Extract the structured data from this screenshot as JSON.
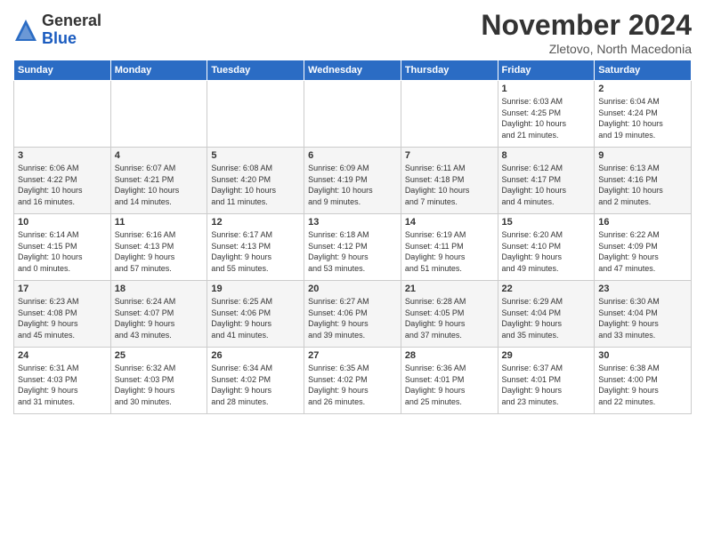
{
  "logo": {
    "general": "General",
    "blue": "Blue"
  },
  "title": "November 2024",
  "subtitle": "Zletovo, North Macedonia",
  "headers": [
    "Sunday",
    "Monday",
    "Tuesday",
    "Wednesday",
    "Thursday",
    "Friday",
    "Saturday"
  ],
  "weeks": [
    [
      {
        "day": "",
        "info": ""
      },
      {
        "day": "",
        "info": ""
      },
      {
        "day": "",
        "info": ""
      },
      {
        "day": "",
        "info": ""
      },
      {
        "day": "",
        "info": ""
      },
      {
        "day": "1",
        "info": "Sunrise: 6:03 AM\nSunset: 4:25 PM\nDaylight: 10 hours\nand 21 minutes."
      },
      {
        "day": "2",
        "info": "Sunrise: 6:04 AM\nSunset: 4:24 PM\nDaylight: 10 hours\nand 19 minutes."
      }
    ],
    [
      {
        "day": "3",
        "info": "Sunrise: 6:06 AM\nSunset: 4:22 PM\nDaylight: 10 hours\nand 16 minutes."
      },
      {
        "day": "4",
        "info": "Sunrise: 6:07 AM\nSunset: 4:21 PM\nDaylight: 10 hours\nand 14 minutes."
      },
      {
        "day": "5",
        "info": "Sunrise: 6:08 AM\nSunset: 4:20 PM\nDaylight: 10 hours\nand 11 minutes."
      },
      {
        "day": "6",
        "info": "Sunrise: 6:09 AM\nSunset: 4:19 PM\nDaylight: 10 hours\nand 9 minutes."
      },
      {
        "day": "7",
        "info": "Sunrise: 6:11 AM\nSunset: 4:18 PM\nDaylight: 10 hours\nand 7 minutes."
      },
      {
        "day": "8",
        "info": "Sunrise: 6:12 AM\nSunset: 4:17 PM\nDaylight: 10 hours\nand 4 minutes."
      },
      {
        "day": "9",
        "info": "Sunrise: 6:13 AM\nSunset: 4:16 PM\nDaylight: 10 hours\nand 2 minutes."
      }
    ],
    [
      {
        "day": "10",
        "info": "Sunrise: 6:14 AM\nSunset: 4:15 PM\nDaylight: 10 hours\nand 0 minutes."
      },
      {
        "day": "11",
        "info": "Sunrise: 6:16 AM\nSunset: 4:13 PM\nDaylight: 9 hours\nand 57 minutes."
      },
      {
        "day": "12",
        "info": "Sunrise: 6:17 AM\nSunset: 4:13 PM\nDaylight: 9 hours\nand 55 minutes."
      },
      {
        "day": "13",
        "info": "Sunrise: 6:18 AM\nSunset: 4:12 PM\nDaylight: 9 hours\nand 53 minutes."
      },
      {
        "day": "14",
        "info": "Sunrise: 6:19 AM\nSunset: 4:11 PM\nDaylight: 9 hours\nand 51 minutes."
      },
      {
        "day": "15",
        "info": "Sunrise: 6:20 AM\nSunset: 4:10 PM\nDaylight: 9 hours\nand 49 minutes."
      },
      {
        "day": "16",
        "info": "Sunrise: 6:22 AM\nSunset: 4:09 PM\nDaylight: 9 hours\nand 47 minutes."
      }
    ],
    [
      {
        "day": "17",
        "info": "Sunrise: 6:23 AM\nSunset: 4:08 PM\nDaylight: 9 hours\nand 45 minutes."
      },
      {
        "day": "18",
        "info": "Sunrise: 6:24 AM\nSunset: 4:07 PM\nDaylight: 9 hours\nand 43 minutes."
      },
      {
        "day": "19",
        "info": "Sunrise: 6:25 AM\nSunset: 4:06 PM\nDaylight: 9 hours\nand 41 minutes."
      },
      {
        "day": "20",
        "info": "Sunrise: 6:27 AM\nSunset: 4:06 PM\nDaylight: 9 hours\nand 39 minutes."
      },
      {
        "day": "21",
        "info": "Sunrise: 6:28 AM\nSunset: 4:05 PM\nDaylight: 9 hours\nand 37 minutes."
      },
      {
        "day": "22",
        "info": "Sunrise: 6:29 AM\nSunset: 4:04 PM\nDaylight: 9 hours\nand 35 minutes."
      },
      {
        "day": "23",
        "info": "Sunrise: 6:30 AM\nSunset: 4:04 PM\nDaylight: 9 hours\nand 33 minutes."
      }
    ],
    [
      {
        "day": "24",
        "info": "Sunrise: 6:31 AM\nSunset: 4:03 PM\nDaylight: 9 hours\nand 31 minutes."
      },
      {
        "day": "25",
        "info": "Sunrise: 6:32 AM\nSunset: 4:03 PM\nDaylight: 9 hours\nand 30 minutes."
      },
      {
        "day": "26",
        "info": "Sunrise: 6:34 AM\nSunset: 4:02 PM\nDaylight: 9 hours\nand 28 minutes."
      },
      {
        "day": "27",
        "info": "Sunrise: 6:35 AM\nSunset: 4:02 PM\nDaylight: 9 hours\nand 26 minutes."
      },
      {
        "day": "28",
        "info": "Sunrise: 6:36 AM\nSunset: 4:01 PM\nDaylight: 9 hours\nand 25 minutes."
      },
      {
        "day": "29",
        "info": "Sunrise: 6:37 AM\nSunset: 4:01 PM\nDaylight: 9 hours\nand 23 minutes."
      },
      {
        "day": "30",
        "info": "Sunrise: 6:38 AM\nSunset: 4:00 PM\nDaylight: 9 hours\nand 22 minutes."
      }
    ]
  ]
}
